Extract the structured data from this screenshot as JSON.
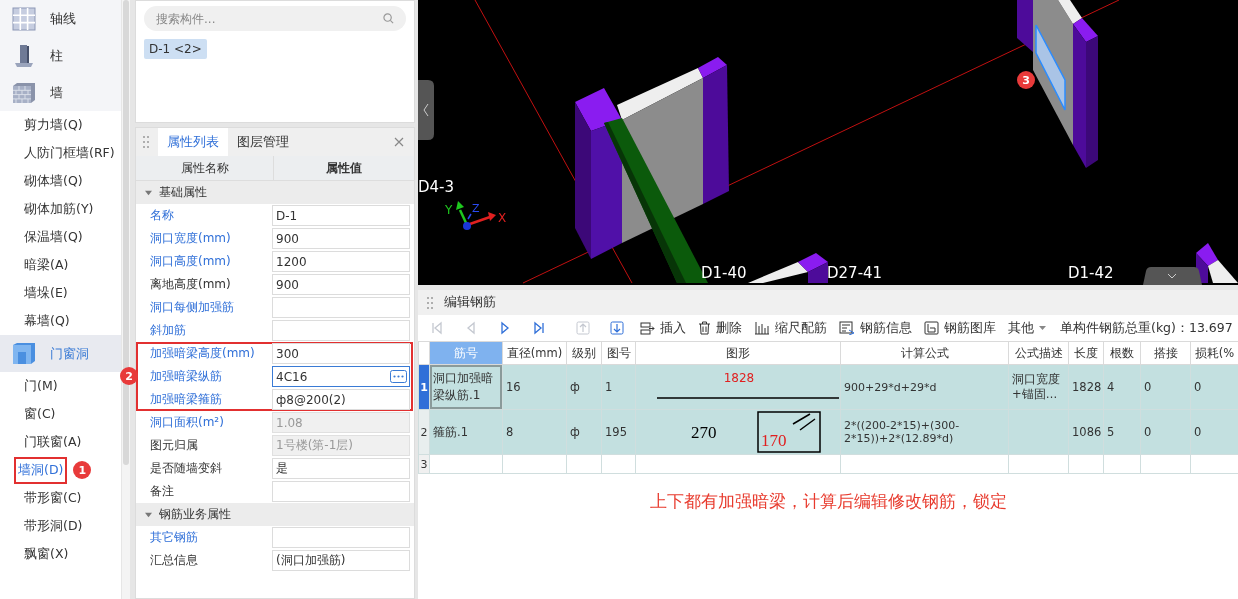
{
  "sidebar": {
    "groups": [
      {
        "label": "轴线",
        "kind": "grid",
        "selected": false
      },
      {
        "label": "柱",
        "kind": "column",
        "selected": false
      },
      {
        "label": "墙",
        "kind": "wall",
        "selected": false,
        "items": [
          {
            "label": "剪力墙(Q)",
            "selected": false
          },
          {
            "label": "人防门框墙(RF)",
            "selected": false
          },
          {
            "label": "砌体墙(Q)",
            "selected": false
          },
          {
            "label": "砌体加筋(Y)",
            "selected": false
          },
          {
            "label": "保温墙(Q)",
            "selected": false
          },
          {
            "label": "暗梁(A)",
            "selected": false
          },
          {
            "label": "墙垛(E)",
            "selected": false
          },
          {
            "label": "幕墙(Q)",
            "selected": false
          }
        ]
      },
      {
        "label": "门窗洞",
        "kind": "opening",
        "selected": true,
        "items": [
          {
            "label": "门(M)",
            "selected": false
          },
          {
            "label": "窗(C)",
            "selected": false
          },
          {
            "label": "门联窗(A)",
            "selected": false
          },
          {
            "label": "墙洞(D)",
            "selected": true,
            "badge": "1"
          },
          {
            "label": "带形窗(C)",
            "selected": false
          },
          {
            "label": "带形洞(D)",
            "selected": false
          },
          {
            "label": "飘窗(X)",
            "selected": false
          }
        ]
      }
    ]
  },
  "component_list": {
    "search": {
      "placeholder": "搜索构件..."
    },
    "items": [
      {
        "label": "D-1 <2>",
        "selected": true
      }
    ]
  },
  "properties": {
    "tabs": [
      {
        "label": "属性列表",
        "selected": true
      },
      {
        "label": "图层管理",
        "selected": false
      }
    ],
    "columns": [
      "属性名称",
      "属性值"
    ],
    "sections": [
      {
        "title": "基础属性",
        "expanded": true,
        "rows": [
          {
            "name": "名称",
            "value": "D-1",
            "linked": true,
            "disabled": false,
            "marked": false,
            "editing": false
          },
          {
            "name": "洞口宽度(mm)",
            "value": "900",
            "linked": true,
            "disabled": false,
            "marked": false,
            "editing": false
          },
          {
            "name": "洞口高度(mm)",
            "value": "1200",
            "linked": true,
            "disabled": false,
            "marked": false,
            "editing": false
          },
          {
            "name": "离地高度(mm)",
            "value": "900",
            "linked": false,
            "disabled": false,
            "marked": false,
            "editing": false
          },
          {
            "name": "洞口每侧加强筋",
            "linked": true,
            "disabled": false,
            "marked": false,
            "editing": false
          },
          {
            "name": "斜加筋",
            "linked": true,
            "disabled": false,
            "marked": false,
            "editing": false
          },
          {
            "name": "加强暗梁高度(mm)",
            "value": "300",
            "linked": true,
            "disabled": false,
            "marked": true,
            "editing": false
          },
          {
            "name": "加强暗梁纵筋",
            "value": "4C16",
            "linked": true,
            "disabled": false,
            "marked": true,
            "editing": true,
            "badge": "2"
          },
          {
            "name": "加强暗梁箍筋",
            "value": "ф8@200(2)",
            "linked": true,
            "disabled": false,
            "marked": true,
            "editing": false
          },
          {
            "name": "洞口面积(m²)",
            "value": "1.08",
            "linked": true,
            "disabled": true,
            "marked": false,
            "editing": false
          },
          {
            "name": "图元归属",
            "value": "1号楼(第-1层)",
            "linked": false,
            "disabled": true,
            "marked": false,
            "editing": false
          },
          {
            "name": "是否随墙变斜",
            "value": "是",
            "linked": false,
            "disabled": false,
            "marked": false,
            "editing": false
          },
          {
            "name": "备注",
            "linked": false,
            "disabled": false,
            "marked": false,
            "editing": false
          }
        ]
      },
      {
        "title": "钢筋业务属性",
        "expanded": true,
        "rows": [
          {
            "name": "其它钢筋",
            "linked": true,
            "disabled": false,
            "marked": false,
            "editing": false
          },
          {
            "name": "汇总信息",
            "value": "(洞口加强筋)",
            "linked": false,
            "disabled": false,
            "marked": false,
            "editing": false
          }
        ]
      }
    ]
  },
  "viewport": {
    "labels": [
      "D4-3",
      "D1-40",
      "D27-41",
      "D1-42"
    ],
    "axes": [
      "Y",
      "Z",
      "X"
    ],
    "badge": "3"
  },
  "rebar_editor": {
    "title": "编辑钢筋",
    "toolbar": {
      "nav": [
        {
          "kind": "first",
          "disabled": true
        },
        {
          "kind": "prev",
          "disabled": true
        },
        {
          "kind": "next",
          "disabled": false
        },
        {
          "kind": "last",
          "disabled": false
        },
        {
          "kind": "up",
          "disabled": true
        },
        {
          "kind": "down",
          "disabled": false
        }
      ],
      "actions": [
        {
          "label": "插入",
          "kind": "insert"
        },
        {
          "label": "删除",
          "kind": "delete"
        },
        {
          "label": "缩尺配筋",
          "kind": "scale"
        },
        {
          "label": "钢筋信息",
          "kind": "info"
        },
        {
          "label": "钢筋图库",
          "kind": "library"
        },
        {
          "label": "其他",
          "kind": "dropdown"
        }
      ],
      "total": "单构件钢筋总重(kg)：13.697"
    },
    "columns": [
      "筋号",
      "直径(mm)",
      "级别",
      "图号",
      "图形",
      "计算公式",
      "公式描述",
      "长度",
      "根数",
      "搭接",
      "损耗(%"
    ],
    "rows": [
      {
        "number": "1",
        "selected": true,
        "bar_no": "洞口加强暗梁纵筋.1",
        "diameter": "16",
        "grade": "ф",
        "figure_no": "1",
        "shape": {
          "kind": "line",
          "dims": [
            "1828"
          ]
        },
        "formula": "900+29*d+29*d",
        "description": "洞口宽度+锚固…",
        "length": "1828",
        "count": "4",
        "lap": "0",
        "loss": "0"
      },
      {
        "number": "2",
        "selected": false,
        "bar_no": "箍筋.1",
        "diameter": "8",
        "grade": "ф",
        "figure_no": "195",
        "shape": {
          "kind": "stirrup",
          "dims": [
            "270",
            "170"
          ]
        },
        "formula": "2*((200-2*15)+(300-2*15))+2*(12.89*d)",
        "length": "1086",
        "count": "5",
        "lap": "0",
        "loss": "0"
      },
      {
        "number": "3",
        "selected": false
      }
    ]
  },
  "note": "上下都有加强暗梁，计算后编辑修改钢筋，锁定"
}
